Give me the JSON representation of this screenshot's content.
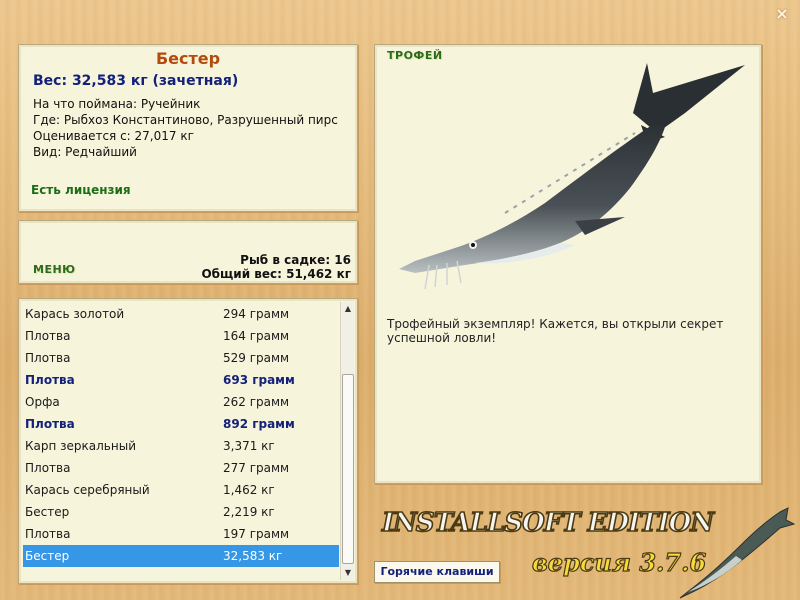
{
  "window": {
    "close_glyph": "×"
  },
  "info": {
    "fish_name": "Бестер",
    "weight_line": "Вес: 32,583 кг (зачетная)",
    "details": [
      "На что поймана: Ручейник",
      "Где: Рыбхоз Константиново, Разрушенный пирс",
      "Оценивается с: 27,017 кг",
      "Вид: Редчайший"
    ],
    "license": "Есть лицензия"
  },
  "menu": {
    "label": "МЕНЮ",
    "fish_in_keepnet": "Рыб в садке: 16",
    "total_weight": "Общий вес: 51,462 кг"
  },
  "catch_list": [
    {
      "name": "Карась золотой",
      "weight": "294 грамм",
      "style": "normal"
    },
    {
      "name": "Плотва",
      "weight": "164 грамм",
      "style": "normal"
    },
    {
      "name": "Плотва",
      "weight": "529 грамм",
      "style": "normal"
    },
    {
      "name": "Плотва",
      "weight": "693 грамм",
      "style": "bold"
    },
    {
      "name": "Орфа",
      "weight": "262 грамм",
      "style": "normal"
    },
    {
      "name": "Плотва",
      "weight": "892 грамм",
      "style": "bold"
    },
    {
      "name": "Карп зеркальный",
      "weight": "3,371 кг",
      "style": "normal"
    },
    {
      "name": "Плотва",
      "weight": "277 грамм",
      "style": "normal"
    },
    {
      "name": "Карась серебряный",
      "weight": "1,462 кг",
      "style": "normal"
    },
    {
      "name": "Бестер",
      "weight": "2,219 кг",
      "style": "normal"
    },
    {
      "name": "Плотва",
      "weight": "197 грамм",
      "style": "normal"
    },
    {
      "name": "Бестер",
      "weight": "32,583 кг",
      "style": "selected"
    }
  ],
  "trophy": {
    "title": "ТРОФЕЙ",
    "message": "Трофейный экземпляр! Кажется, вы открыли секрет успешной ловли!"
  },
  "hotkeys_button": "Горячие клавиши",
  "logo": {
    "brand": "INSTALLSOFT EDITION",
    "version": "версия 3.7.6"
  },
  "colors": {
    "accent_title": "#b34a0e",
    "weight_blue": "#13217a",
    "license_green": "#1c6e16",
    "selection": "#3597e6"
  }
}
